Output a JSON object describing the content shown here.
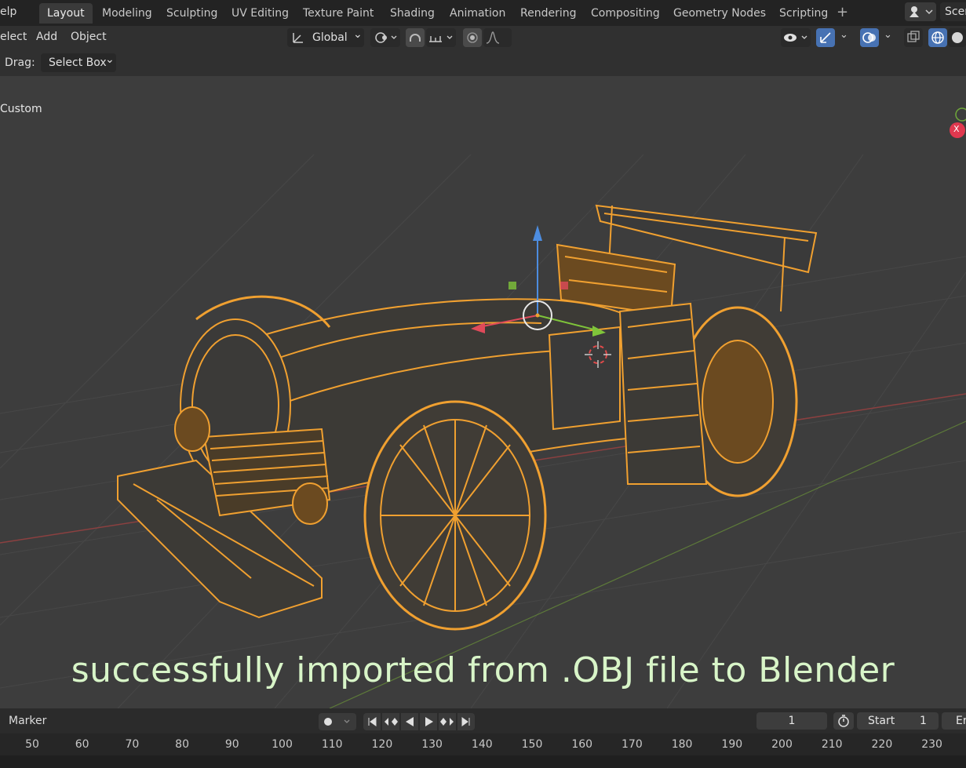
{
  "topbar": {
    "help_fragment": "elp",
    "tabs": [
      {
        "label": "Layout",
        "active": true
      },
      {
        "label": "Modeling"
      },
      {
        "label": "Sculpting"
      },
      {
        "label": "UV Editing"
      },
      {
        "label": "Texture Paint"
      },
      {
        "label": "Shading"
      },
      {
        "label": "Animation"
      },
      {
        "label": "Rendering"
      },
      {
        "label": "Compositing"
      },
      {
        "label": "Geometry Nodes"
      },
      {
        "label": "Scripting"
      }
    ],
    "plus_icon": "+",
    "scene_label": "Scen"
  },
  "header": {
    "menu_select": "elect",
    "menu_add": "Add",
    "menu_object": "Object",
    "orientation": "Global",
    "chevron": "⌄"
  },
  "toolheader": {
    "drag_label": "Drag:",
    "drag_value": "Select Box"
  },
  "viewport": {
    "view_label": "Custom",
    "caption": "successfully imported from .OBJ file to Blender",
    "axis_x_label": "X"
  },
  "timeline": {
    "marker_label": "Marker",
    "current_frame": "1",
    "start_label": "Start",
    "start_value": "1",
    "end_fragment": "Er",
    "ruler": [
      "50",
      "60",
      "70",
      "80",
      "90",
      "100",
      "110",
      "120",
      "130",
      "140",
      "150",
      "160",
      "170",
      "180",
      "190",
      "200",
      "210",
      "220",
      "230"
    ]
  },
  "colors": {
    "accent": "#4772b3",
    "selection": "#f0a030",
    "viewport_bg": "#3d3d3d"
  }
}
